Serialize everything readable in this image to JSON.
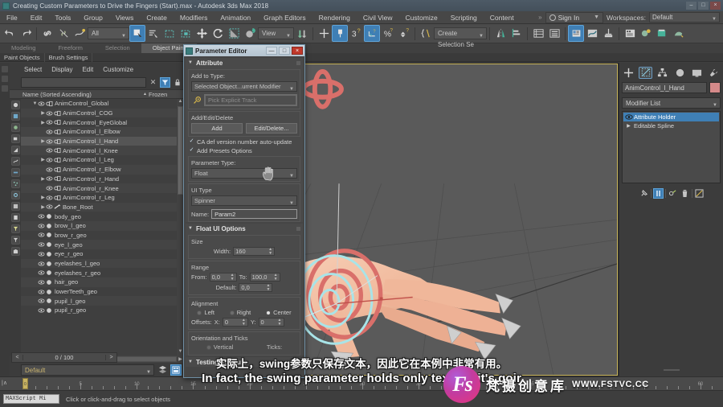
{
  "window": {
    "title": "Creating Custom Parameters to Drive the Fingers (Start).max - Autodesk 3ds Max 2018",
    "min": "–",
    "max": "□",
    "close": "×"
  },
  "menubar": {
    "items": [
      "File",
      "Edit",
      "Tools",
      "Group",
      "Views",
      "Create",
      "Modifiers",
      "Animation",
      "Graph Editors",
      "Rendering",
      "Civil View",
      "Customize",
      "Scripting",
      "Content"
    ],
    "overflow": "»",
    "sign_in": "Sign In",
    "workspaces_label": "Workspaces:",
    "workspace_value": "Default"
  },
  "toolbar": {
    "selection_filter": "All",
    "reference_coord": "View",
    "selection_set": "Create Selection Se",
    "icons": [
      "undo-icon",
      "redo-icon",
      "select-link-icon",
      "unlink-icon",
      "bind-space-warp-icon",
      "select-object-icon",
      "select-by-name-icon",
      "rect-select-icon",
      "window-crossing-icon",
      "select-move-icon",
      "select-rotate-icon",
      "select-scale-icon",
      "select-place-icon",
      "mirror-icon",
      "align-icon",
      "snap-toggle-icon",
      "angle-snap-icon",
      "percent-snap-icon",
      "spinner-snap-icon",
      "named-set-icon",
      "mirror2-icon",
      "align2-icon",
      "layer-explorer-icon",
      "scene-explorer-icon",
      "curve-editor-icon",
      "schematic-view-icon",
      "material-editor-icon",
      "render-setup-icon",
      "render-frame-icon",
      "render-production-icon"
    ]
  },
  "ribbon": {
    "tabs": [
      "Modeling",
      "Freeform",
      "Selection",
      "Object Paint"
    ],
    "active": "Object Paint",
    "subtabs": [
      "Paint Objects",
      "Brush Settings"
    ]
  },
  "explorer": {
    "menus": [
      "Select",
      "Display",
      "Edit",
      "Customize"
    ],
    "search_value": "",
    "columns": [
      "Name (Sorted Ascending)",
      "Frozen"
    ],
    "sort_arrow": "▲",
    "items": [
      {
        "name": "AnimControl_Global",
        "indent": 0,
        "expand": "▼",
        "icon": "control-icon",
        "selected": false
      },
      {
        "name": "AnimControl_COG",
        "indent": 1,
        "expand": "▶",
        "icon": "control-icon",
        "selected": false
      },
      {
        "name": "AnimControl_EyeGlobal",
        "indent": 1,
        "expand": "▶",
        "icon": "control-icon",
        "selected": false
      },
      {
        "name": "AnimControl_l_Elbow",
        "indent": 1,
        "expand": "",
        "icon": "control-icon",
        "selected": false
      },
      {
        "name": "AnimControl_l_Hand",
        "indent": 1,
        "expand": "▶",
        "icon": "control-icon",
        "selected": true
      },
      {
        "name": "AnimControl_l_Knee",
        "indent": 1,
        "expand": "",
        "icon": "control-icon",
        "selected": false
      },
      {
        "name": "AnimControl_l_Leg",
        "indent": 1,
        "expand": "▶",
        "icon": "control-icon",
        "selected": false
      },
      {
        "name": "AnimControl_r_Elbow",
        "indent": 1,
        "expand": "",
        "icon": "control-icon",
        "selected": false
      },
      {
        "name": "AnimControl_r_Hand",
        "indent": 1,
        "expand": "▶",
        "icon": "control-icon",
        "selected": false
      },
      {
        "name": "AnimControl_r_Knee",
        "indent": 1,
        "expand": "",
        "icon": "control-icon",
        "selected": false
      },
      {
        "name": "AnimControl_r_Leg",
        "indent": 1,
        "expand": "▶",
        "icon": "control-icon",
        "selected": false
      },
      {
        "name": "Bone_Root",
        "indent": 1,
        "expand": "▶",
        "icon": "bone-icon",
        "selected": false
      },
      {
        "name": "body_geo",
        "indent": 0,
        "expand": "",
        "icon": "geo-icon",
        "selected": false
      },
      {
        "name": "brow_l_geo",
        "indent": 0,
        "expand": "",
        "icon": "geo-icon",
        "selected": false
      },
      {
        "name": "brow_r_geo",
        "indent": 0,
        "expand": "",
        "icon": "geo-icon",
        "selected": false
      },
      {
        "name": "eye_l_geo",
        "indent": 0,
        "expand": "",
        "icon": "geo-icon",
        "selected": false
      },
      {
        "name": "eye_r_geo",
        "indent": 0,
        "expand": "",
        "icon": "geo-icon",
        "selected": false
      },
      {
        "name": "eyelashes_l_geo",
        "indent": 0,
        "expand": "",
        "icon": "geo-icon",
        "selected": false
      },
      {
        "name": "eyelashes_r_geo",
        "indent": 0,
        "expand": "",
        "icon": "geo-icon",
        "selected": false
      },
      {
        "name": "hair_geo",
        "indent": 0,
        "expand": "",
        "icon": "geo-icon",
        "selected": false
      },
      {
        "name": "lowerTeeth_geo",
        "indent": 0,
        "expand": "",
        "icon": "geo-icon",
        "selected": false
      },
      {
        "name": "pupil_l_geo",
        "indent": 0,
        "expand": "",
        "icon": "geo-icon",
        "selected": false
      },
      {
        "name": "pupil_r_geo",
        "indent": 0,
        "expand": "",
        "icon": "geo-icon",
        "selected": false
      }
    ]
  },
  "layer_bar": {
    "current_layer": "Default"
  },
  "command_panel": {
    "tabs": [
      "create-tab-icon",
      "modify-tab-icon",
      "hierarchy-tab-icon",
      "motion-tab-icon",
      "display-tab-icon",
      "utilities-tab-icon"
    ],
    "object_name": "AnimControl_l_Hand",
    "color_swatch": "#d58a8a",
    "modifier_list_label": "Modifier List",
    "modifiers": [
      {
        "label": "Attribute Holder",
        "selected": true
      },
      {
        "label": "Editable Spline",
        "selected": false
      }
    ],
    "stack_tools": [
      "pin-stack-icon",
      "show-end-result-icon",
      "make-unique-icon",
      "remove-modifier-icon",
      "configure-sets-icon"
    ]
  },
  "parameter_editor": {
    "title": "Parameter Editor",
    "min": "—",
    "max": "□",
    "close": "×",
    "rollouts": {
      "attribute": {
        "header": "Attribute",
        "add_to_type_label": "Add to Type:",
        "add_to_type_value": "Selected Object...urrent Modifier",
        "pick_track_placeholder": "Pick Explicit Track",
        "add_edit_delete_label": "Add/Edit/Delete",
        "add_button": "Add",
        "edit_delete_button": "Edit/Delete...",
        "checkbox_autoupdate": "CA def version number auto-update",
        "checkbox_presets": "Add Presets Options",
        "parameter_type_label": "Parameter Type:",
        "parameter_type_value": "Float",
        "ui_type_label": "UI Type",
        "ui_type_value": "Spinner",
        "name_label": "Name:",
        "name_value": "Param2"
      },
      "float_ui": {
        "header": "Float UI Options",
        "size_label": "Size",
        "width_label": "Width:",
        "width_value": "160",
        "range_label": "Range",
        "from_label": "From:",
        "from_value": "0,0",
        "to_label": "To:",
        "to_value": "100,0",
        "default_label": "Default:",
        "default_value": "0,0",
        "alignment_label": "Alignment",
        "align_left": "Left",
        "align_right": "Right",
        "align_center": "Center",
        "align_selected": "Center",
        "offsets_label": "Offsets:",
        "offset_x_label": "X:",
        "offset_x_value": "0",
        "offset_y_label": "Y:",
        "offset_y_value": "0"
      },
      "orientation": {
        "header": "Orientation and Ticks",
        "vertical": "Vertical",
        "ticks_label": "Ticks:"
      },
      "testing": {
        "header": "Testing Attribute"
      }
    }
  },
  "timeline": {
    "frame_display": "0 / 100",
    "prev": "<",
    "next": ">",
    "current_frame": "0",
    "tick_labels": [
      "5",
      "10",
      "15",
      "20",
      "25",
      "30",
      "35",
      "40",
      "45",
      "50",
      "55",
      "60"
    ]
  },
  "statusbar": {
    "maxscript_label": "MAXScript Mi",
    "prompt": "Click or click-and-drag to select objects"
  },
  "subtitles": {
    "chinese": "实际上，swing参数只保存文本，因此它在本例中非常有用。",
    "english": "In fact, the swing parameter holds only text, so it's goir"
  },
  "watermark": {
    "logo": "Fs",
    "brand": "梵摄创意库",
    "url": "WWW.FSTVC.CC"
  }
}
